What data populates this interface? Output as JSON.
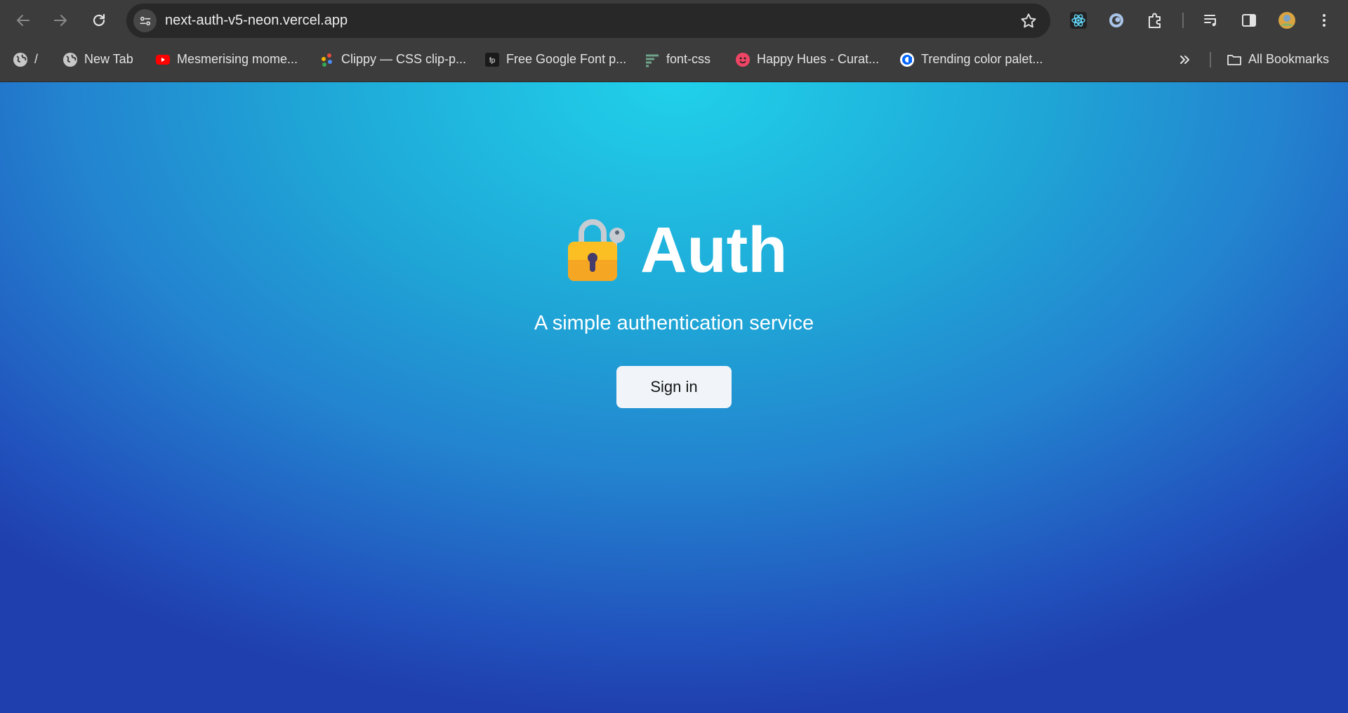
{
  "browser": {
    "url": "next-auth-v5-neon.vercel.app",
    "bookmarks": [
      {
        "label": "/",
        "icon": "globe-icon"
      },
      {
        "label": "New Tab",
        "icon": "globe-icon"
      },
      {
        "label": "Mesmerising mome...",
        "icon": "youtube-icon"
      },
      {
        "label": "Clippy — CSS clip-p...",
        "icon": "clippy-dots-icon"
      },
      {
        "label": "Free Google Font p...",
        "icon": "fontpair-icon"
      },
      {
        "label": "font-css",
        "icon": "lines-icon"
      },
      {
        "label": "Happy Hues - Curat...",
        "icon": "smiley-icon"
      },
      {
        "label": "Trending color palet...",
        "icon": "coolors-icon"
      }
    ],
    "all_bookmarks_label": "All Bookmarks"
  },
  "page": {
    "title": "Auth",
    "subtitle": "A simple authentication service",
    "signin_label": "Sign in",
    "colors": {
      "gradient_top": "#20d1ea",
      "gradient_bottom": "#1f3fae",
      "button_bg": "#f1f5f9",
      "lock_body": "#fbbf24"
    }
  }
}
